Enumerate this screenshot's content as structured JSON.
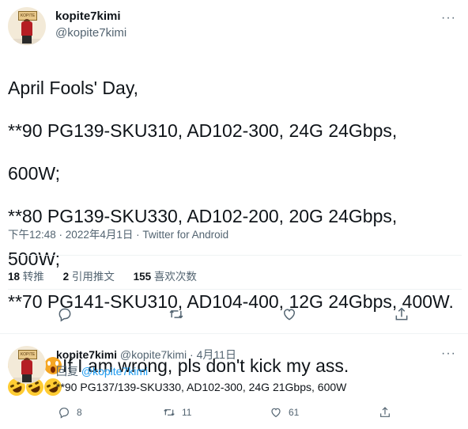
{
  "author": {
    "name": "kopite7kimi",
    "handle": "@kopite7kimi"
  },
  "tweet": {
    "lines": [
      "April Fools' Day,",
      "**90 PG139-SKU310, AD102-300, 24G 24Gbps,",
      "600W;",
      "**80 PG139-SKU330, AD102-200, 20G 24Gbps,",
      "500W;",
      "**70 PG141-SKU310, AD104-400, 12G 24Gbps, 400W."
    ],
    "last_line_text": "If I am wrong, pls don't kick my ass.",
    "time": "下午12:48",
    "date": "2022年4月1日",
    "source": "Twitter for Android",
    "sep": " · "
  },
  "stats": {
    "retweets_count": "18",
    "retweets_label": "转推",
    "quotes_count": "2",
    "quotes_label": "引用推文",
    "likes_count": "155",
    "likes_label": "喜欢次数"
  },
  "reply": {
    "name": "kopite7kimi",
    "handle": "@kopite7kimi",
    "date": "4月11日",
    "sep": " · ",
    "replying_prefix": "回复 ",
    "replying_to": "@kopite7kimi",
    "text": "**90 PG137/139-SKU330, AD102-300, 24G 21Gbps, 600W",
    "replies_count": "8",
    "retweets_count": "11",
    "likes_count": "61"
  },
  "colors": {
    "accent": "#1d9bf0",
    "secondary_text": "#536471",
    "divider": "#eff3f4"
  },
  "icons": [
    "more-icon",
    "reply-icon",
    "retweet-icon",
    "like-icon",
    "share-icon",
    "face-screaming-emoji",
    "rofl-emoji"
  ]
}
